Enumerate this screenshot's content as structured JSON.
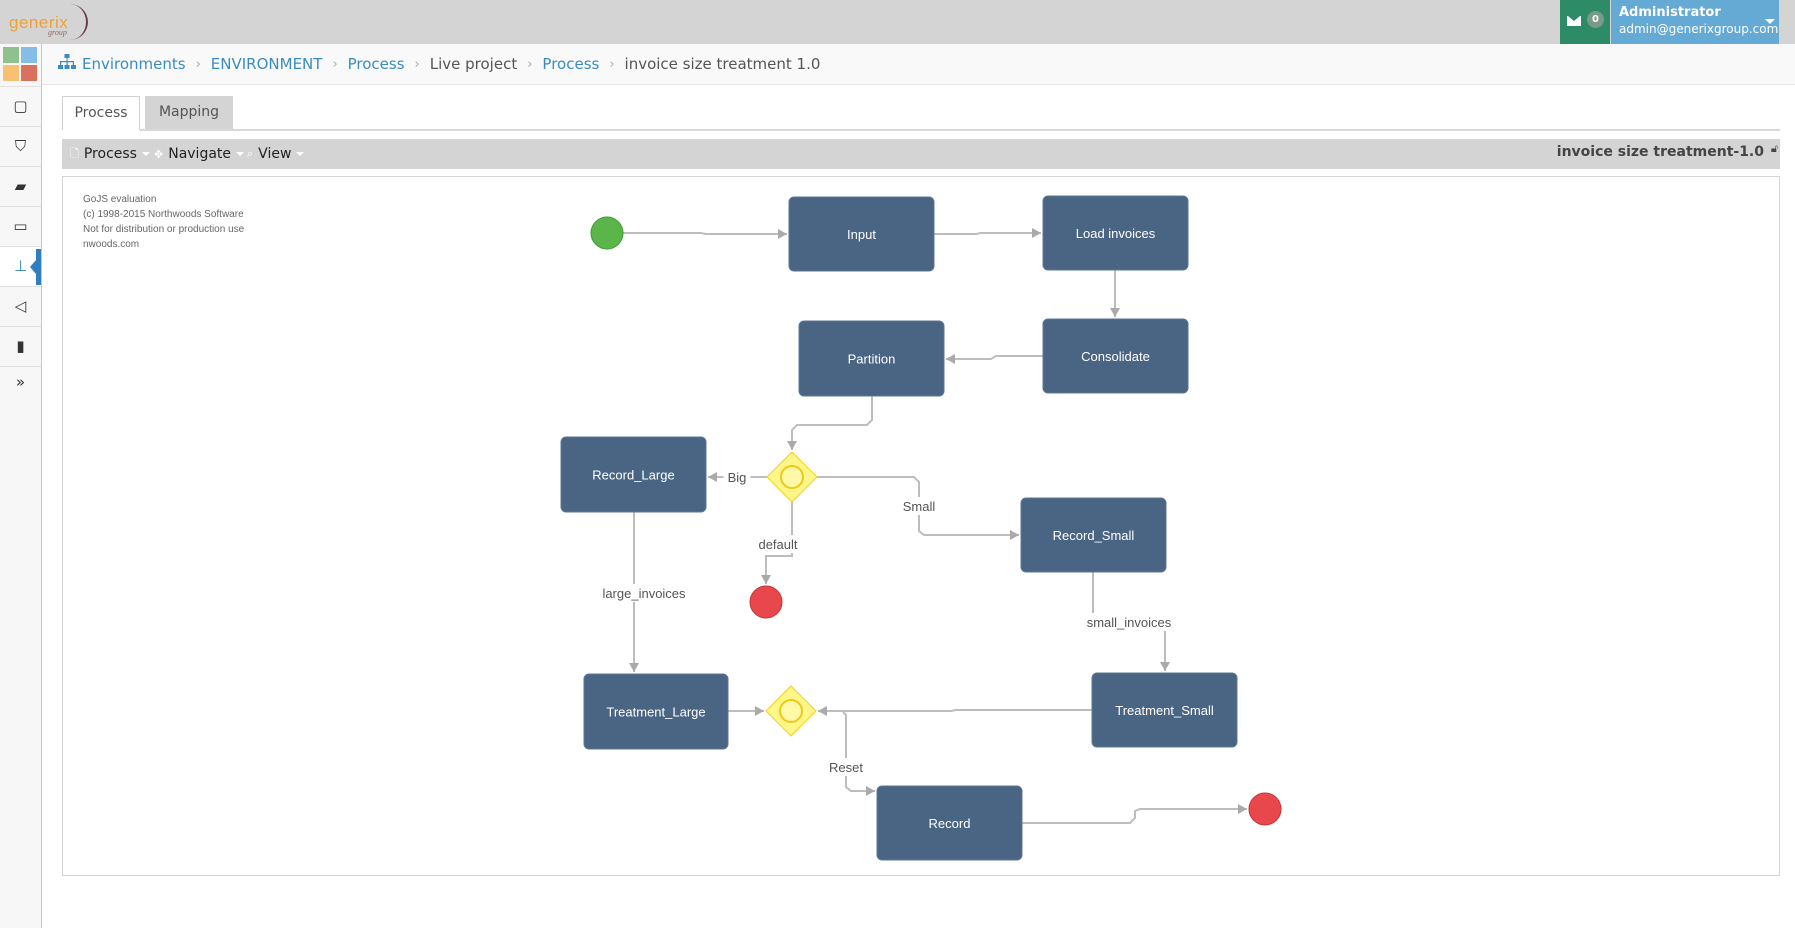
{
  "header": {
    "logo_text": "generix",
    "logo_subtext": "group",
    "mail_count": "0",
    "user_name": "Administrator",
    "user_email": "admin@generixgroup.com"
  },
  "sidebar": {
    "tile_colors": [
      "#8fc18f",
      "#86bde6",
      "#f8c070",
      "#d97060"
    ],
    "items": [
      {
        "icon": "square-icon",
        "glyph": "▢"
      },
      {
        "icon": "shield-icon",
        "glyph": "⛉"
      },
      {
        "icon": "book-icon",
        "glyph": "▰"
      },
      {
        "icon": "monitor-icon",
        "glyph": "▭"
      },
      {
        "icon": "sitemap-icon",
        "glyph": "⊥",
        "active": true
      },
      {
        "icon": "megaphone-icon",
        "glyph": "◁"
      },
      {
        "icon": "bar-chart-icon",
        "glyph": "▮"
      },
      {
        "icon": "expand-icon",
        "glyph": "»"
      }
    ]
  },
  "breadcrumb": [
    {
      "label": "Environments",
      "link": true
    },
    {
      "label": "ENVIRONMENT",
      "link": true
    },
    {
      "label": "Process",
      "link": true
    },
    {
      "label": "Live project",
      "link": false
    },
    {
      "label": "Process",
      "link": true
    },
    {
      "label": "invoice size treatment 1.0",
      "link": false
    }
  ],
  "tabs": [
    {
      "label": "Process",
      "active": true
    },
    {
      "label": "Mapping",
      "active": false
    }
  ],
  "toolbar": {
    "menus": [
      {
        "label": "Process",
        "glyph": "🗋"
      },
      {
        "label": "Navigate",
        "glyph": "✥"
      },
      {
        "label": "View",
        "glyph": "⌕"
      }
    ],
    "title": "invoice size treatment-1.0"
  },
  "watermark": [
    "GoJS evaluation",
    "(c) 1998-2015 Northwoods Software",
    "Not for distribution or production use",
    "nwoods.com"
  ],
  "diagram": {
    "colors": {
      "task": "#4a6583",
      "start": "#5cb54a",
      "end": "#e8484b",
      "gateway": "#fff68a",
      "gateway_stroke": "#f2d21a",
      "link": "#bdbdbd"
    },
    "nodes": [
      {
        "id": "start",
        "type": "start"
      },
      {
        "id": "input",
        "type": "task",
        "label": "Input"
      },
      {
        "id": "load",
        "type": "task",
        "label": "Load invoices"
      },
      {
        "id": "consolidate",
        "type": "task",
        "label": "Consolidate"
      },
      {
        "id": "partition",
        "type": "task",
        "label": "Partition"
      },
      {
        "id": "gw1",
        "type": "gateway"
      },
      {
        "id": "record_large",
        "type": "task",
        "label": "Record_Large"
      },
      {
        "id": "record_small",
        "type": "task",
        "label": "Record_Small"
      },
      {
        "id": "end1",
        "type": "end"
      },
      {
        "id": "treatment_large",
        "type": "task",
        "label": "Treatment_Large"
      },
      {
        "id": "gw2",
        "type": "gateway"
      },
      {
        "id": "treatment_small",
        "type": "task",
        "label": "Treatment_Small"
      },
      {
        "id": "record",
        "type": "task",
        "label": "Record"
      },
      {
        "id": "end2",
        "type": "end"
      }
    ],
    "links": [
      {
        "from": "start",
        "to": "input",
        "label": ""
      },
      {
        "from": "input",
        "to": "load",
        "label": ""
      },
      {
        "from": "load",
        "to": "consolidate",
        "label": ""
      },
      {
        "from": "consolidate",
        "to": "partition",
        "label": ""
      },
      {
        "from": "partition",
        "to": "gw1",
        "label": ""
      },
      {
        "from": "gw1",
        "to": "record_large",
        "label": "Big"
      },
      {
        "from": "gw1",
        "to": "record_small",
        "label": "Small"
      },
      {
        "from": "gw1",
        "to": "end1",
        "label": "default"
      },
      {
        "from": "record_large",
        "to": "treatment_large",
        "label": "large_invoices"
      },
      {
        "from": "record_small",
        "to": "treatment_small",
        "label": "small_invoices"
      },
      {
        "from": "treatment_large",
        "to": "gw2",
        "label": ""
      },
      {
        "from": "treatment_small",
        "to": "gw2",
        "label": ""
      },
      {
        "from": "gw2",
        "to": "record",
        "label": "Reset"
      },
      {
        "from": "record",
        "to": "end2",
        "label": ""
      }
    ]
  }
}
